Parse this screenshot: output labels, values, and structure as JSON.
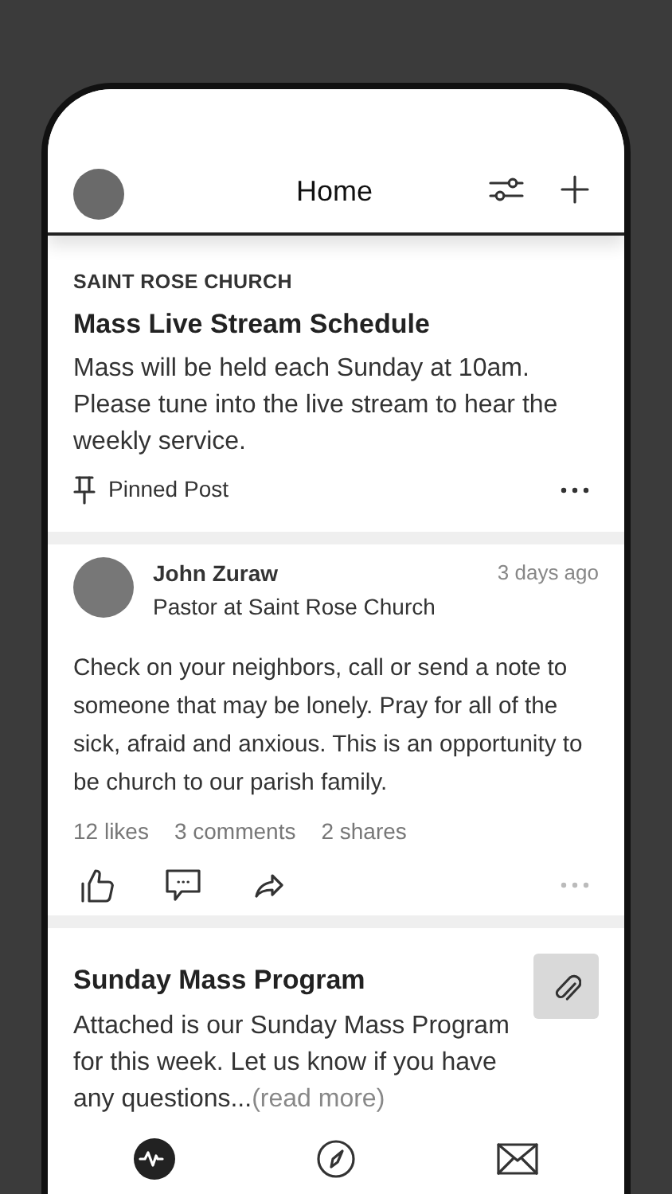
{
  "header": {
    "title": "Home"
  },
  "pinned_post": {
    "organization": "SAINT ROSE CHURCH",
    "title": "Mass Live Stream Schedule",
    "body": "Mass will be held each Sunday at 10am. Please tune into the live stream to hear the weekly service.",
    "pinned_label": "Pinned Post"
  },
  "post": {
    "author": "John Zuraw",
    "role": "Pastor at Saint Rose Church",
    "time": "3 days ago",
    "body": "Check on your neighbors, call or send a note to someone that may be lonely. Pray for all of the sick, afraid and anxious. This is an opportunity to be church to our parish family.",
    "stats": [
      "12 likes",
      "3 comments",
      "2 shares"
    ]
  },
  "attachment_post": {
    "title": "Sunday Mass Program",
    "body": "Attached is our Sunday Mass Program for this week. Let us know if you have any questions...",
    "read_more": "(read more)"
  },
  "tabs": [
    {
      "kind": "activity",
      "selected": true
    },
    {
      "kind": "explore",
      "selected": false
    },
    {
      "kind": "messages",
      "selected": false
    }
  ]
}
